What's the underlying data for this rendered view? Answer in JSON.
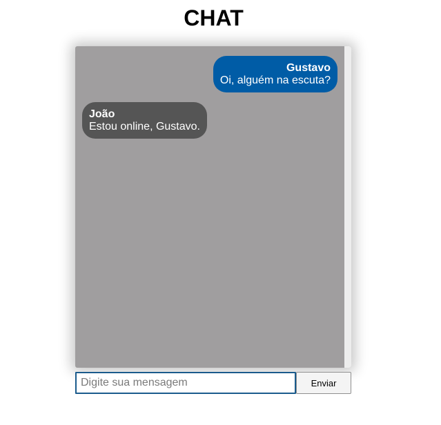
{
  "header": {
    "title": "CHAT"
  },
  "messages": [
    {
      "sender": "Gustavo",
      "text": "Oi, alguém na escuta?",
      "direction": "outgoing",
      "color": "#005ca6"
    },
    {
      "sender": "João",
      "text": "Estou online, Gustavo.",
      "direction": "incoming",
      "color": "#555555"
    }
  ],
  "composer": {
    "input_value": "",
    "input_placeholder": "Digite sua mensagem",
    "send_label": "Enviar"
  },
  "colors": {
    "panel_background": "#a09e9f",
    "outgoing_bubble": "#005ca6",
    "incoming_bubble": "#555555",
    "input_border": "#1a5b8c"
  }
}
